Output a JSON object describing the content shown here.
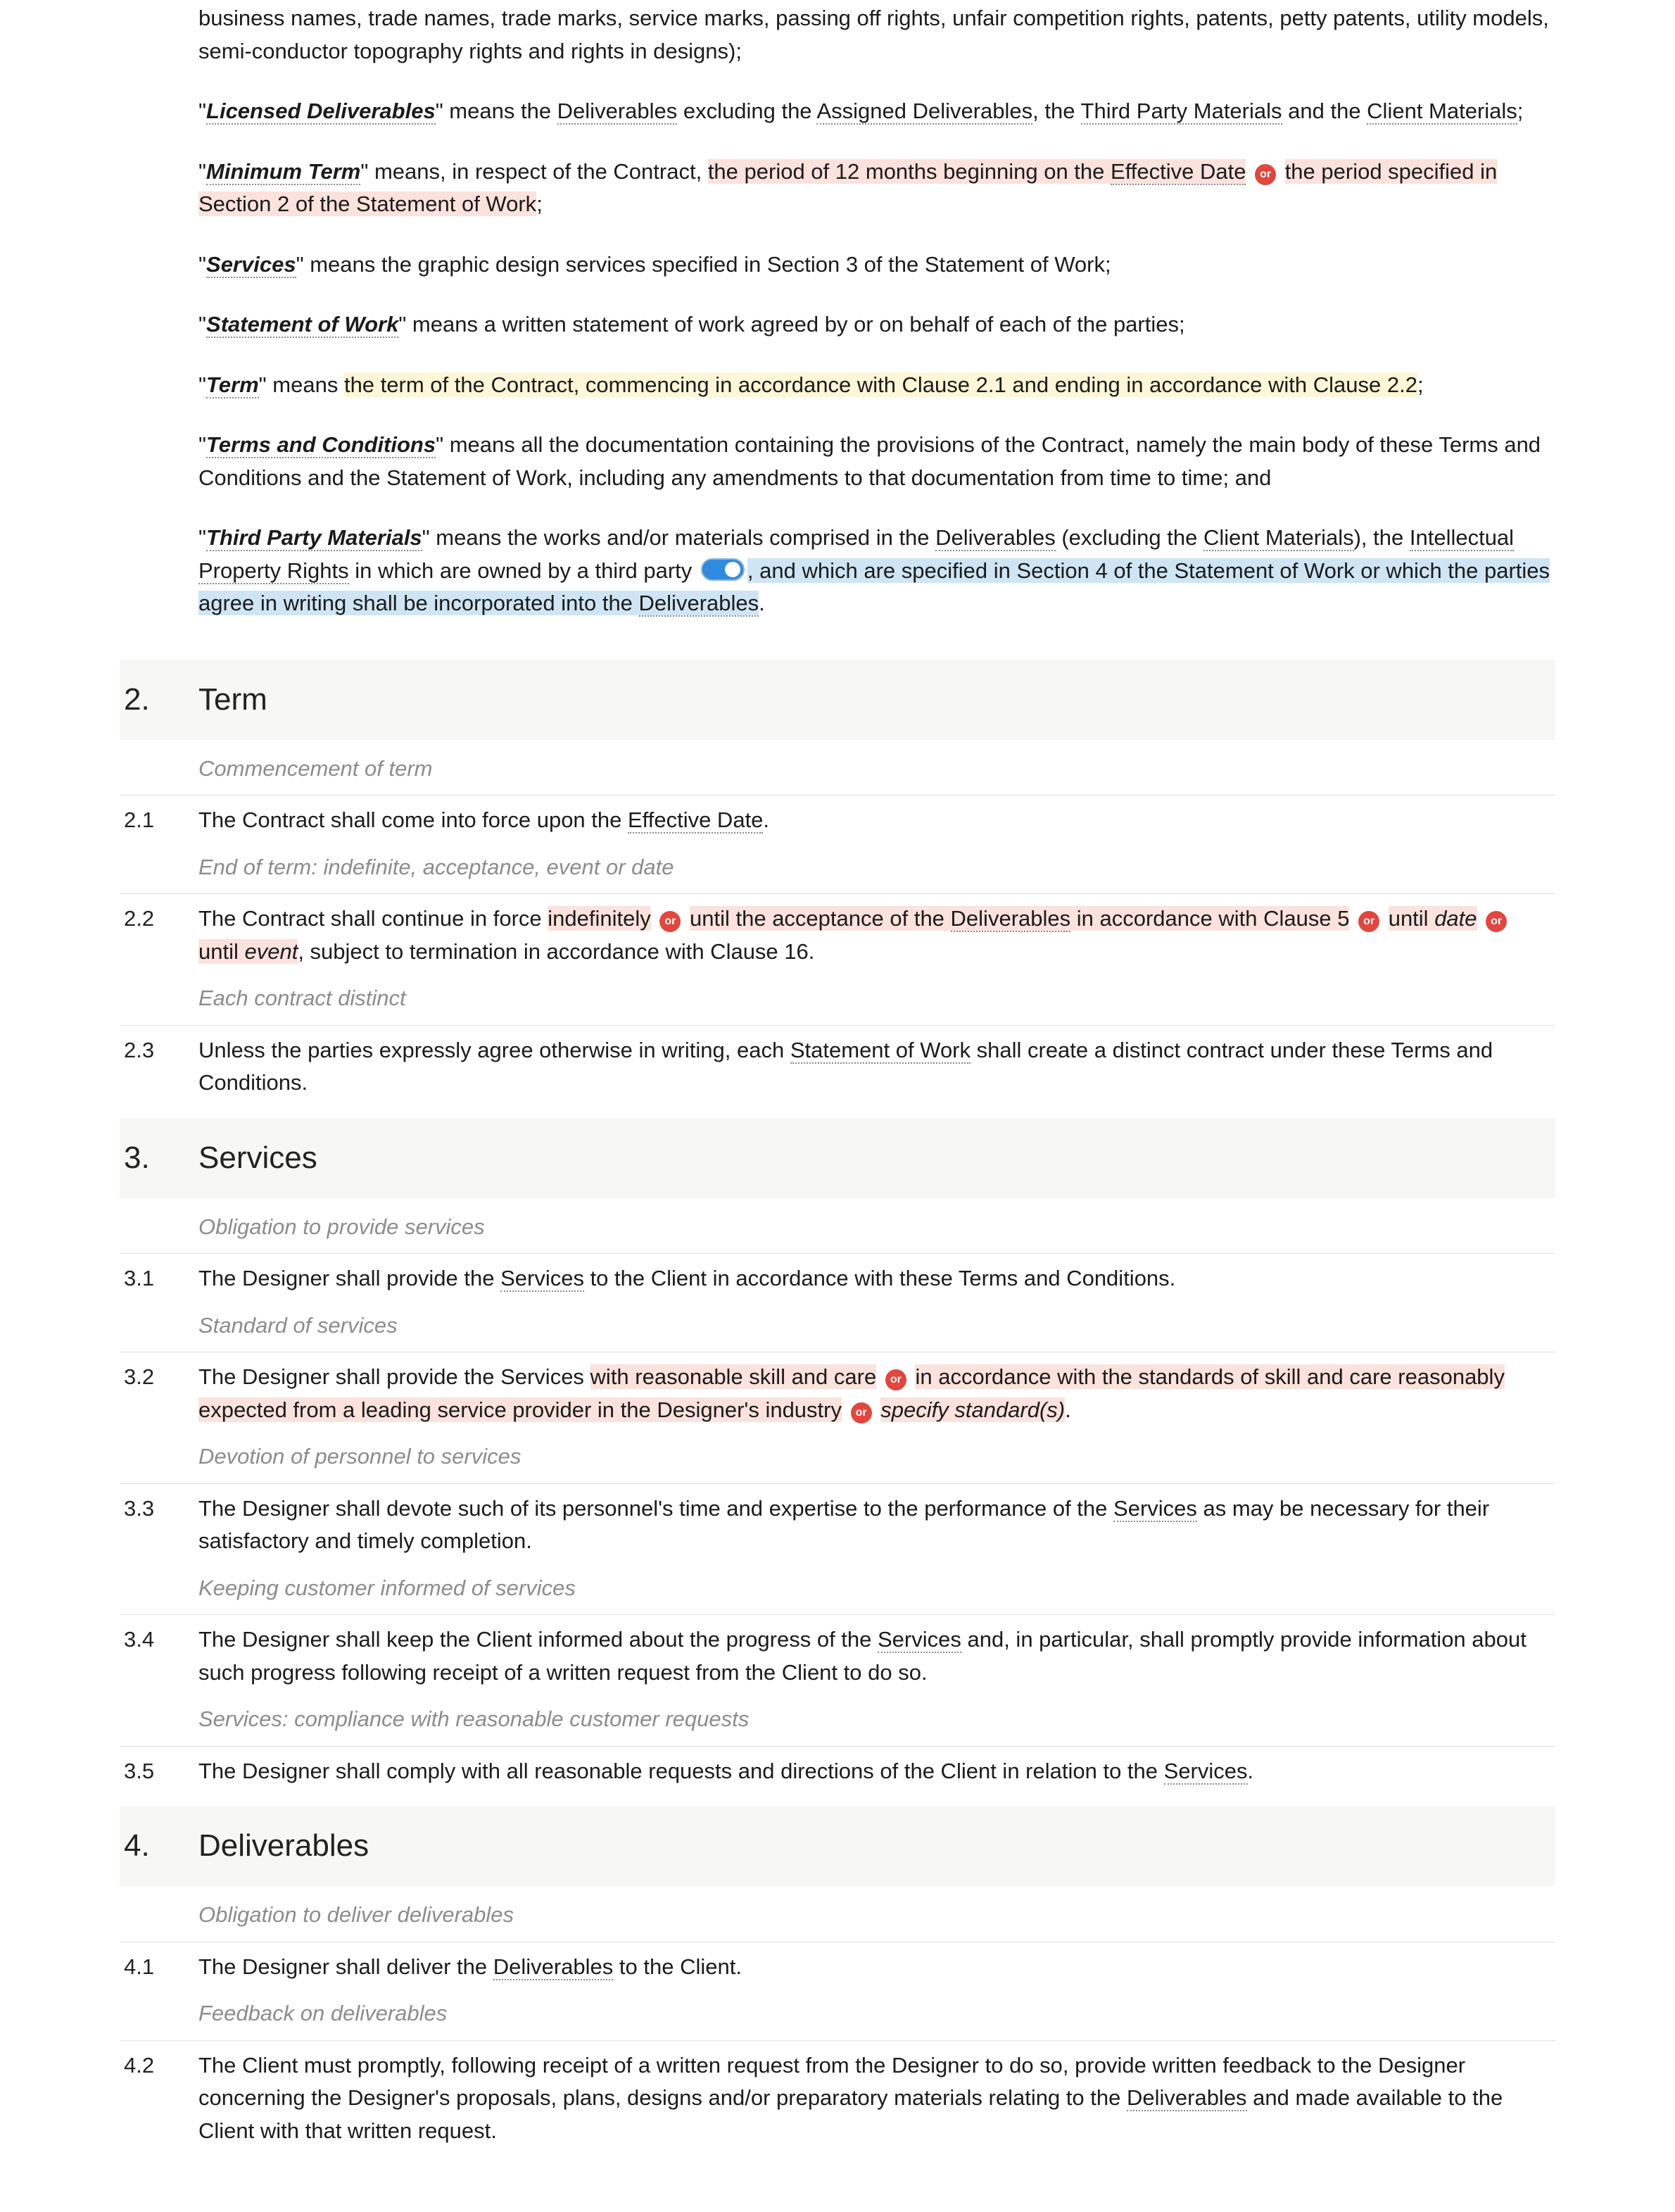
{
  "or_label": "or",
  "defs": {
    "ip_tail": "business names, trade names, trade marks, service marks, passing off rights, unfair competition rights, patents, petty patents, utility models, semi-conductor topography rights and rights in designs);",
    "licensed": {
      "term": "Licensed Deliverables",
      "pre": "\" means the ",
      "d1": "Deliverables",
      "mid1": " excluding the ",
      "d2": "Assigned Deliverables",
      "mid2": ", the ",
      "d3": "Third Party Materials",
      "mid3": " and the ",
      "d4": "Client Materials",
      "post": ";"
    },
    "minimum": {
      "term": "Minimum Term",
      "pre": "\" means, in respect of the Contract, ",
      "opt1a": "the period of 12 months beginning on the ",
      "eff": "Effective Date",
      "opt2": " the period specified in Section 2 of the Statement of Work",
      "post": ";"
    },
    "services": {
      "term": "Services",
      "body": "\" means the graphic design services specified in Section 3 of the Statement of Work;"
    },
    "sow": {
      "term": "Statement of Work",
      "body": "\" means a written statement of work agreed by or on behalf of each of the parties;"
    },
    "term_def": {
      "term": "Term",
      "pre": "\" means ",
      "body": "the term of the Contract, commencing in accordance with Clause 2.1 and ending in accordance with Clause 2.2",
      "post": ";"
    },
    "tnc": {
      "term": "Terms and Conditions",
      "body": "\" means all the documentation containing the provisions of the Contract, namely the main body of these Terms and Conditions and the Statement of Work, including any amendments to that documentation from time to time; and"
    },
    "tpm": {
      "term": "Third Party Materials",
      "pre": "\" means the works and/or materials comprised in the ",
      "d1": "Deliverables",
      "mid1": " (excluding the ",
      "d2": "Client Materials",
      "mid2": "), the ",
      "d3": "Intellectual Property Rights",
      "mid3": " in which are owned by a third party ",
      "tog_a": ", and which are specified in Section 4 of the Statement of Work or which the parties agree in writing shall be incorporated into the ",
      "d4": "Deliverables",
      "post": "."
    }
  },
  "sections": {
    "s2": {
      "num": "2.",
      "title": "Term"
    },
    "s3": {
      "num": "3.",
      "title": "Services"
    },
    "s4": {
      "num": "4.",
      "title": "Deliverables"
    }
  },
  "annotations": {
    "a21": "Commencement of term",
    "a22": "End of term: indefinite, acceptance, event or date",
    "a23": "Each contract distinct",
    "a31": "Obligation to provide services",
    "a32": "Standard of services",
    "a33": "Devotion of personnel to services",
    "a34": "Keeping customer informed of services",
    "a35": "Services: compliance with reasonable customer requests",
    "a41": "Obligation to deliver deliverables",
    "a42": "Feedback on deliverables"
  },
  "clauses": {
    "c21": {
      "num": "2.1",
      "pre": "The Contract shall come into force upon the ",
      "eff": "Effective Date",
      "post": "."
    },
    "c22": {
      "num": "2.2",
      "pre": "The Contract shall continue in force ",
      "opt1": "indefinitely",
      "opt2a": " until the acceptance of the ",
      "d1": "Deliverables",
      "opt2b": " in accordance with Clause 5",
      "opt3": " until ",
      "fill1": "date",
      "opt4": " until ",
      "fill2": "event",
      "post": ", subject to termination in accordance with Clause 16."
    },
    "c23": {
      "num": "2.3",
      "pre": "Unless the parties expressly agree otherwise in writing, each ",
      "sow": "Statement of Work",
      "post": " shall create a distinct contract under these Terms and Conditions."
    },
    "c31": {
      "num": "3.1",
      "pre": "The Designer shall provide the ",
      "svc": "Services",
      "post": " to the Client in accordance with these Terms and Conditions."
    },
    "c32": {
      "num": "3.2",
      "pre": "The Designer shall provide the Services ",
      "opt1": "with reasonable skill and care",
      "opt2": " in accordance with the standards of skill and care reasonably expected from a leading service provider in the Designer's industry",
      "fill": "specify standard(s)",
      "post": "."
    },
    "c33": {
      "num": "3.3",
      "pre": "The Designer shall devote such of its personnel's time and expertise to the performance of the ",
      "svc": "Services",
      "post": " as may be necessary for their satisfactory and timely completion."
    },
    "c34": {
      "num": "3.4",
      "pre": "The Designer shall keep the Client informed about the progress of the ",
      "svc": "Services",
      "post": " and, in particular, shall promptly provide information about such progress following receipt of a written request from the Client to do so."
    },
    "c35": {
      "num": "3.5",
      "pre": "The Designer shall comply with all reasonable requests and directions of the Client in relation to the ",
      "svc": "Services",
      "post": "."
    },
    "c41": {
      "num": "4.1",
      "pre": "The Designer shall deliver the ",
      "d1": "Deliverables",
      "post": " to the Client."
    },
    "c42": {
      "num": "4.2",
      "pre": "The Client must promptly, following receipt of a written request from the Designer to do so, provide written feedback to the Designer concerning the Designer's proposals, plans, designs and/or preparatory materials relating to the ",
      "d1": "Deliverables",
      "post": " and made available to the Client with that written request."
    }
  }
}
